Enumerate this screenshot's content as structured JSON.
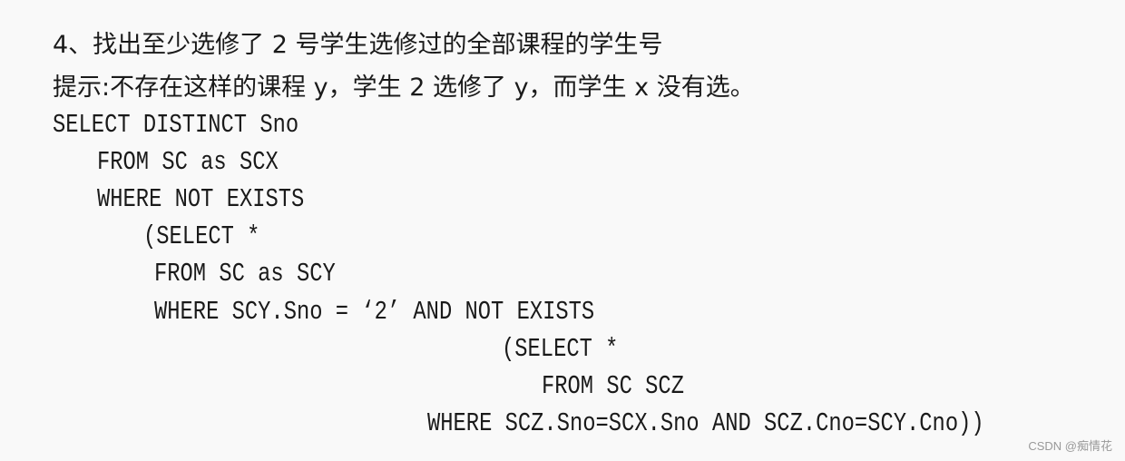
{
  "title": "4、找出至少选修了 2 号学生选修过的全部课程的学生号",
  "hint": "提示:不存在这样的课程 y，学生 2 选修了 y，而学生 x 没有选。",
  "code_lines": [
    "SELECT DISTINCT Sno",
    "FROM SC as SCX",
    "WHERE NOT EXISTS",
    "(SELECT *",
    "FROM SC as SCY",
    "WHERE SCY.Sno = ‘2’ AND NOT EXISTS",
    "(SELECT *",
    "FROM SC SCZ",
    "WHERE SCZ.Sno=SCX.Sno AND SCZ.Cno=SCY.Cno))"
  ],
  "watermark": "CSDN @痴情花"
}
